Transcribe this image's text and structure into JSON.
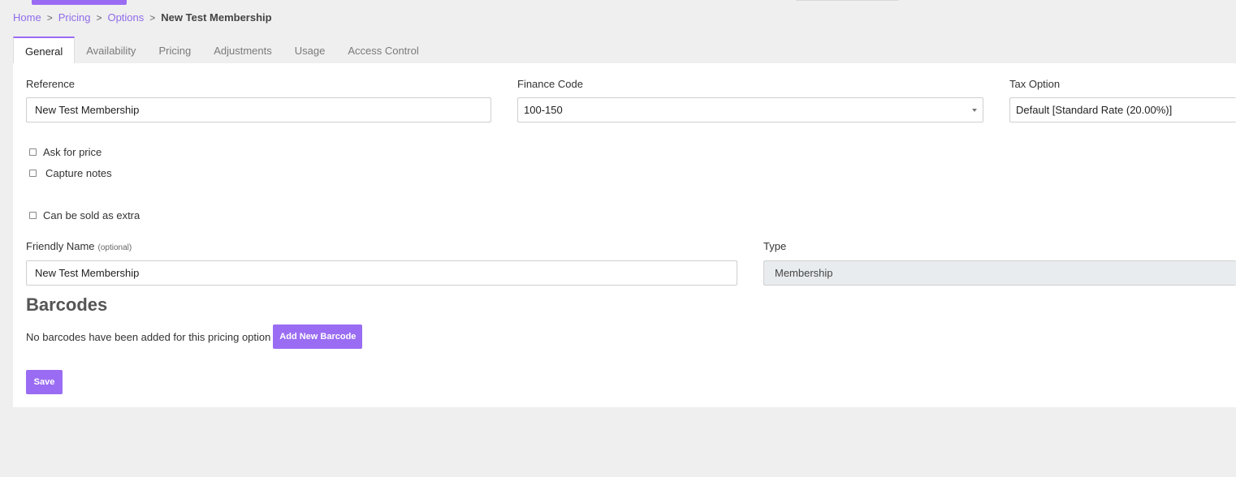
{
  "breadcrumb": {
    "items": [
      "Home",
      "Pricing",
      "Options"
    ],
    "current": "New Test Membership",
    "separator": ">"
  },
  "tabs": [
    {
      "label": "General",
      "active": true
    },
    {
      "label": "Availability"
    },
    {
      "label": "Pricing"
    },
    {
      "label": "Adjustments"
    },
    {
      "label": "Usage"
    },
    {
      "label": "Access Control"
    }
  ],
  "general": {
    "reference": {
      "label": "Reference",
      "value": "New Test Membership"
    },
    "finance_code": {
      "label": "Finance Code",
      "value": "100-150"
    },
    "tax_option": {
      "label": "Tax Option",
      "value": "Default [Standard Rate (20.00%)]"
    },
    "checkboxes": [
      {
        "label": "Ask for price",
        "checked": false
      },
      {
        "label": "Capture notes",
        "checked": false
      },
      {
        "label": "Can be sold as extra",
        "checked": false
      }
    ],
    "friendly_name": {
      "label": "Friendly Name",
      "optional": "(optional)",
      "value": "New Test Membership"
    },
    "type": {
      "label": "Type",
      "value": "Membership"
    }
  },
  "barcodes": {
    "title": "Barcodes",
    "empty_text": "No barcodes have been added for this pricing option",
    "add_button": "Add New Barcode"
  },
  "actions": {
    "save": "Save"
  },
  "colors": {
    "accent": "#9a6cf3",
    "link": "#8f6bea",
    "page_bg": "#efefef",
    "panel_bg": "#ffffff"
  }
}
